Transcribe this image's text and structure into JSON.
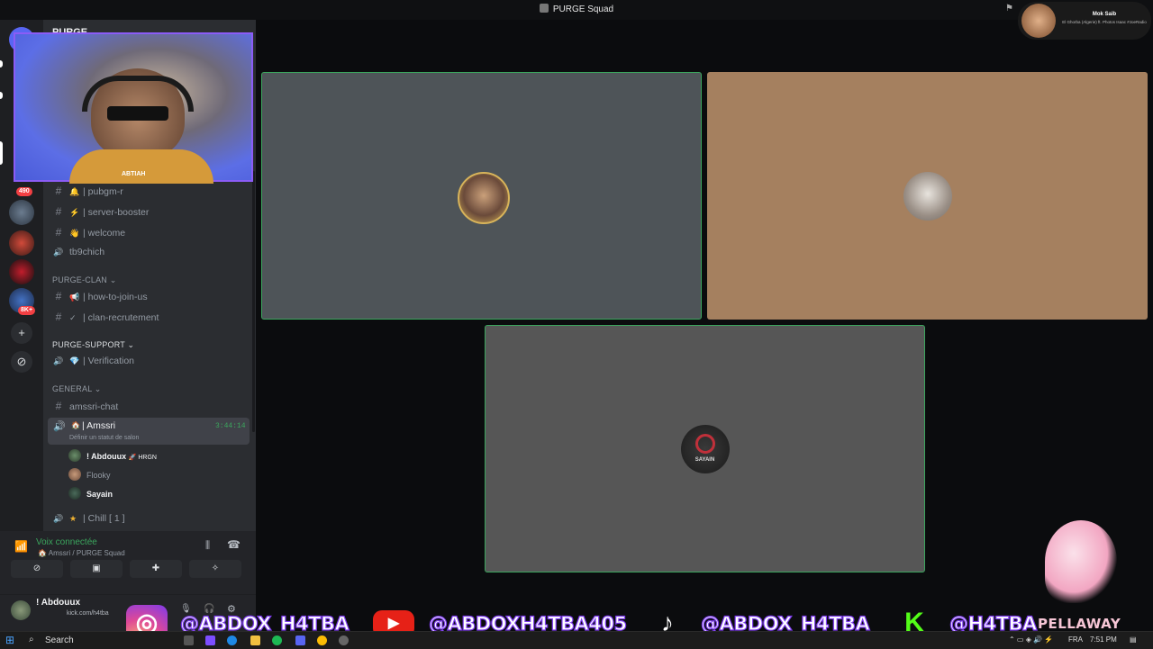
{
  "window": {
    "title": "PURGE Squad"
  },
  "rail": {
    "unread_badge": "490",
    "server_badge": "8K+"
  },
  "channels": {
    "partial_header": "PURGE",
    "items_top": [
      {
        "glyph": "#",
        "emoji": "🔔",
        "label": "| pubgm-r"
      },
      {
        "glyph": "#",
        "emoji": "⚡",
        "label": "| server-booster"
      },
      {
        "glyph": "#",
        "emoji": "👋",
        "label": "| welcome"
      },
      {
        "glyph": "🔊",
        "emoji": "",
        "label": "tb9chich"
      }
    ],
    "categories": {
      "purge_clan": "PURGE-CLAN",
      "purge_support": "PURGE-SUPPORT",
      "general": "GENERAL"
    },
    "clan_items": [
      {
        "glyph": "#",
        "emoji": "📢",
        "label": "| how-to-join-us"
      },
      {
        "glyph": "#",
        "emoji": "✓",
        "label": "| clan-recrutement"
      }
    ],
    "support_items": [
      {
        "glyph": "🔊",
        "emoji": "💎",
        "label": "| Verification"
      }
    ],
    "general_items": [
      {
        "glyph": "#",
        "emoji": "",
        "label": "amssri-chat"
      }
    ],
    "active_voice": {
      "label": "| Amssri",
      "timer": "3:44:14",
      "status": "Définir un statut de salon"
    },
    "members": [
      {
        "name": "! Abdouux",
        "tag": "HRGN",
        "color": "#f2f3f5"
      },
      {
        "name": "Flooky",
        "tag": "",
        "color": "#949ba4"
      },
      {
        "name": "Sayain",
        "tag": "",
        "color": "#f2f3f5"
      }
    ],
    "chill": {
      "label": "| Chill [ 1 ]"
    }
  },
  "voice": {
    "status": "Voix connectée",
    "location": "Amssri / PURGE Squad"
  },
  "user": {
    "name": "! Abdouux",
    "sub": "kick.com/h4tba"
  },
  "webcam": {
    "overlay_name": "ABTIAH"
  },
  "tiles": [
    {
      "bg": "#4e5458",
      "border": "#3ba55d",
      "avatar": "man-sunglasses"
    },
    {
      "bg": "#a5805f",
      "border": "#a5805f",
      "avatar": "cat"
    },
    {
      "bg": "#565656",
      "border": "#3ba55d",
      "avatar": "sayain-logo",
      "avatar_text": "SAYAIN"
    }
  ],
  "now_playing": {
    "title": "Mok Saib",
    "subtitle": "El Ghorba (Algerie) ft. Photos Isaac #JoeRadio"
  },
  "socials": {
    "instagram": "@ABDOX_H4TBA",
    "youtube": "@ABDOXH4TBA405",
    "tiktok": "@ABDOX_H4TBA",
    "kick": "@H4TBA",
    "brand": "PELLAWAY"
  },
  "taskbar": {
    "search": "Search",
    "lang": "FRA",
    "time": "7:51 PM"
  },
  "colors": {
    "accent_green": "#3ba55d",
    "sidebar": "#2b2d31",
    "rail": "#1e1f22",
    "purple": "#7c3aed"
  }
}
